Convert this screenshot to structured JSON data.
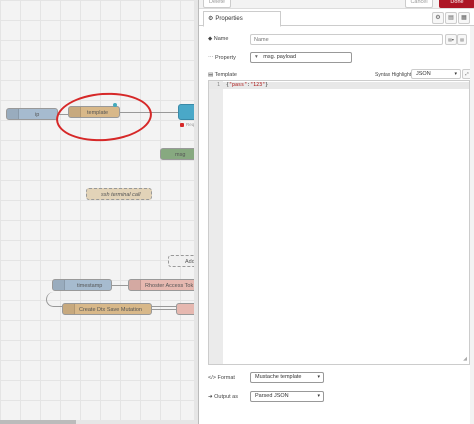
{
  "workspace": {
    "nodes": {
      "in_label": "ip",
      "template_label": "template",
      "msg_label": "msg",
      "ssh_label": "ssh terminal call",
      "add_label": "Add",
      "timestamp_label": "timestamp",
      "rhoster_label": "Rhoster Access Tok",
      "mutation_label": "Create Dtx Save Mutation",
      "req_label": "Req"
    }
  },
  "tray": {
    "delete_label": "Delete",
    "cancel_label": "Cancel",
    "done_label": "Done",
    "tab_label": "Properties",
    "name": {
      "label": "Name",
      "placeholder": "Name"
    },
    "property": {
      "label": "Property",
      "value": "msg. payload"
    },
    "template": {
      "label": "Template",
      "syntax_label": "Syntax Highlight:",
      "syntax_value": "JSON"
    },
    "code": {
      "line_number": "1",
      "open": "{",
      "key": "\"pass\"",
      "colon": ":",
      "val": "\"123\"",
      "close": "}"
    },
    "format": {
      "label": "Format",
      "value": "Mustache template"
    },
    "output": {
      "label": "Output as",
      "value": "Parsed JSON"
    }
  },
  "colors": {
    "accent": "#ad1625",
    "template_node": "#d8b889",
    "annotation": "#d62828"
  }
}
